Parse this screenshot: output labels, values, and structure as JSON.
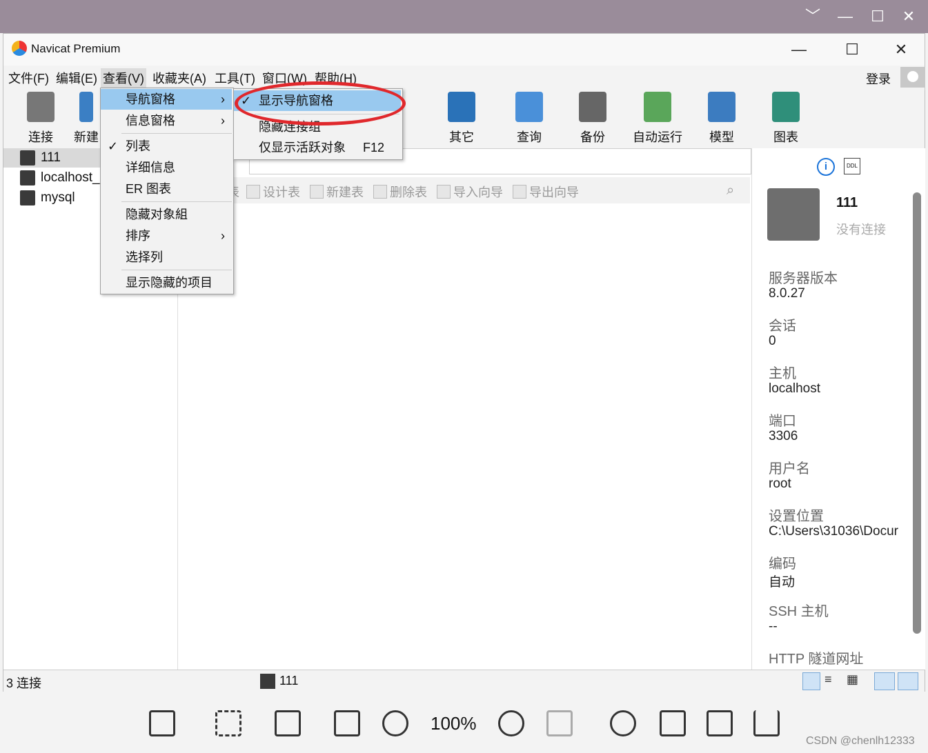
{
  "viewer": {
    "minimize": "﹀",
    "restore": "—",
    "maximize": "☐",
    "close": "✕",
    "zoom": "100%",
    "watermark": "CSDN @chenlh12333"
  },
  "window": {
    "title": "Navicat Premium",
    "minimize": "—",
    "maximize": "☐",
    "close": "✕"
  },
  "menubar": [
    "文件(F)",
    "编辑(E)",
    "查看(V)",
    "收藏夹(A)",
    "工具(T)",
    "窗口(W)",
    "帮助(H)"
  ],
  "login": "登录",
  "toolbar": {
    "connect": "连接",
    "new": "新建",
    "other": "其它",
    "query": "查询",
    "backup": "备份",
    "auto_run": "自动运行",
    "model": "模型",
    "chart": "图表"
  },
  "connections": [
    "111",
    "localhost_",
    "mysql"
  ],
  "object_toolbar": [
    "表",
    "设计表",
    "新建表",
    "删除表",
    "导入向导",
    "导出向导"
  ],
  "view_menu": {
    "nav_pane": "导航窗格",
    "info_pane": "信息窗格",
    "list": "列表",
    "detail": "详细信息",
    "er": "ER 图表",
    "hide_groups": "隐藏对象組",
    "sort": "排序",
    "choose_columns": "选择列",
    "show_hidden": "显示隐藏的项目"
  },
  "nav_submenu": {
    "show_nav": "显示导航窗格",
    "hide_group": "隐藏连接组",
    "active_only": "仅显示活跃对象",
    "shortcut": "F12"
  },
  "info": {
    "name": "111",
    "state": "没有连接",
    "items": [
      {
        "label": "服务器版本",
        "value": "8.0.27"
      },
      {
        "label": "会话",
        "value": "0"
      },
      {
        "label": "主机",
        "value": "localhost"
      },
      {
        "label": "端口",
        "value": "3306"
      },
      {
        "label": "用户名",
        "value": "root"
      },
      {
        "label": "设置位置",
        "value": "C:\\Users\\31036\\Docur"
      },
      {
        "label": "编码",
        "value": "自动"
      },
      {
        "label": "SSH 主机",
        "value": "--"
      },
      {
        "label": "HTTP 隧道网址",
        "value": ""
      }
    ]
  },
  "status": {
    "count": "3 连接",
    "current": "111"
  }
}
